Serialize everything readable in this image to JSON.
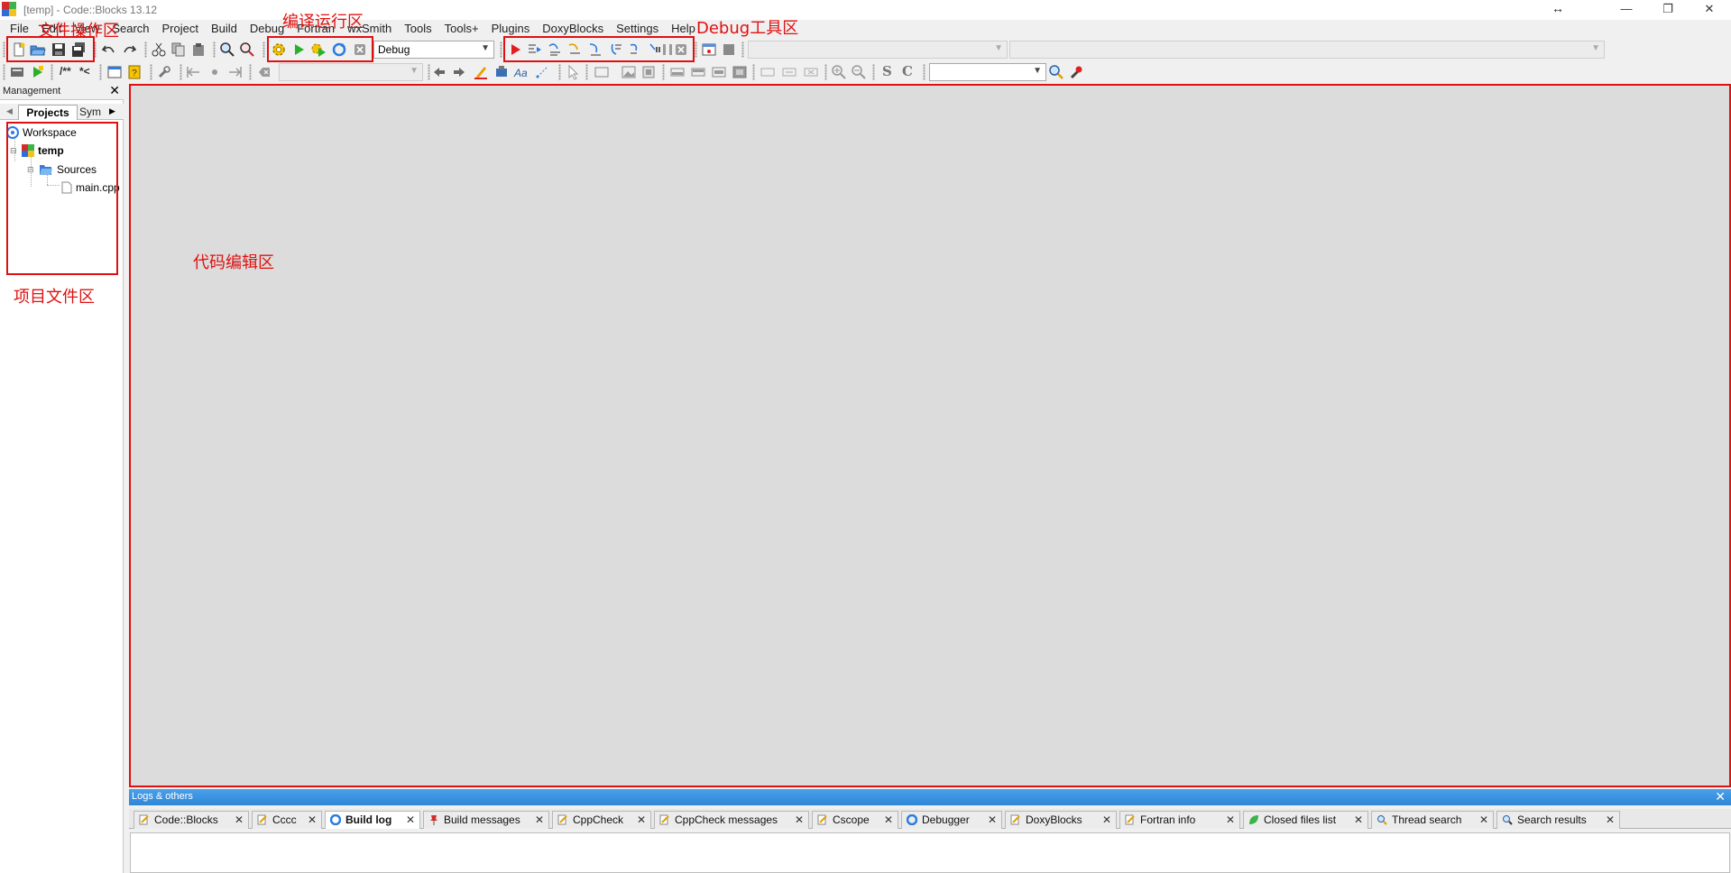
{
  "window": {
    "title": "[temp] - Code::Blocks 13.12",
    "resize_glyph": "↔",
    "minimize_glyph": "—",
    "restore_glyph": "❐",
    "close_glyph": "✕"
  },
  "menu": [
    "File",
    "Edit",
    "View",
    "Search",
    "Project",
    "Build",
    "Debug",
    "Fortran",
    "wxSmith",
    "Tools",
    "Tools+",
    "Plugins",
    "DoxyBlocks",
    "Settings",
    "Help"
  ],
  "toolbar": {
    "build_target": "Debug",
    "doxy_comment_label": "/**",
    "doxy_line_label": "*<",
    "strong_s": "S",
    "strong_c": "C",
    "icons": {
      "new_file": "new-file-icon",
      "open": "open-folder-icon",
      "save": "save-icon",
      "save_all": "save-all-icon",
      "undo": "undo-icon",
      "redo": "redo-icon",
      "cut": "cut-icon",
      "copy": "copy-icon",
      "paste": "paste-icon",
      "find": "find-icon",
      "replace": "replace-icon",
      "build": "gear-build-icon",
      "run": "run-icon",
      "build_run": "build-run-icon",
      "rebuild": "rebuild-icon",
      "abort": "abort-icon",
      "debug": "debug-start-icon",
      "pause": "pause-icon",
      "stop": "stop-icon"
    }
  },
  "management": {
    "title": "Management",
    "close_glyph": "✕",
    "tabs": {
      "projects": "Projects",
      "symbols": "Sym"
    },
    "tree": {
      "workspace": "Workspace",
      "project": "temp",
      "folder": "Sources",
      "file": "main.cpp"
    }
  },
  "logs": {
    "title": "Logs & others",
    "close_glyph": "✕",
    "tabs": [
      {
        "label": "Code::Blocks",
        "active": false,
        "icon": "note-icon"
      },
      {
        "label": "Cccc",
        "active": false,
        "icon": "note-icon"
      },
      {
        "label": "Build log",
        "active": true,
        "icon": "gear-icon"
      },
      {
        "label": "Build messages",
        "active": false,
        "icon": "pin-icon"
      },
      {
        "label": "CppCheck",
        "active": false,
        "icon": "note-icon"
      },
      {
        "label": "CppCheck messages",
        "active": false,
        "icon": "note-icon"
      },
      {
        "label": "Cscope",
        "active": false,
        "icon": "note-icon"
      },
      {
        "label": "Debugger",
        "active": false,
        "icon": "gear-icon"
      },
      {
        "label": "DoxyBlocks",
        "active": false,
        "icon": "note-icon"
      },
      {
        "label": "Fortran info",
        "active": false,
        "icon": "note-icon"
      },
      {
        "label": "Closed files list",
        "active": false,
        "icon": "leaf-icon"
      },
      {
        "label": "Thread search",
        "active": false,
        "icon": "magnifier-icon"
      },
      {
        "label": "Search results",
        "active": false,
        "icon": "magnifier-icon"
      }
    ]
  },
  "annotations": {
    "file_ops": "文件操作区",
    "compile_run": "编译运行区",
    "debug_tools": "Debug工具区",
    "project_files": "项目文件区",
    "code_editor": "代码编辑区"
  },
  "colors": {
    "annotation": "#e01010",
    "logs_header": "#2f86d8",
    "editor_bg": "#dcdcdc"
  }
}
